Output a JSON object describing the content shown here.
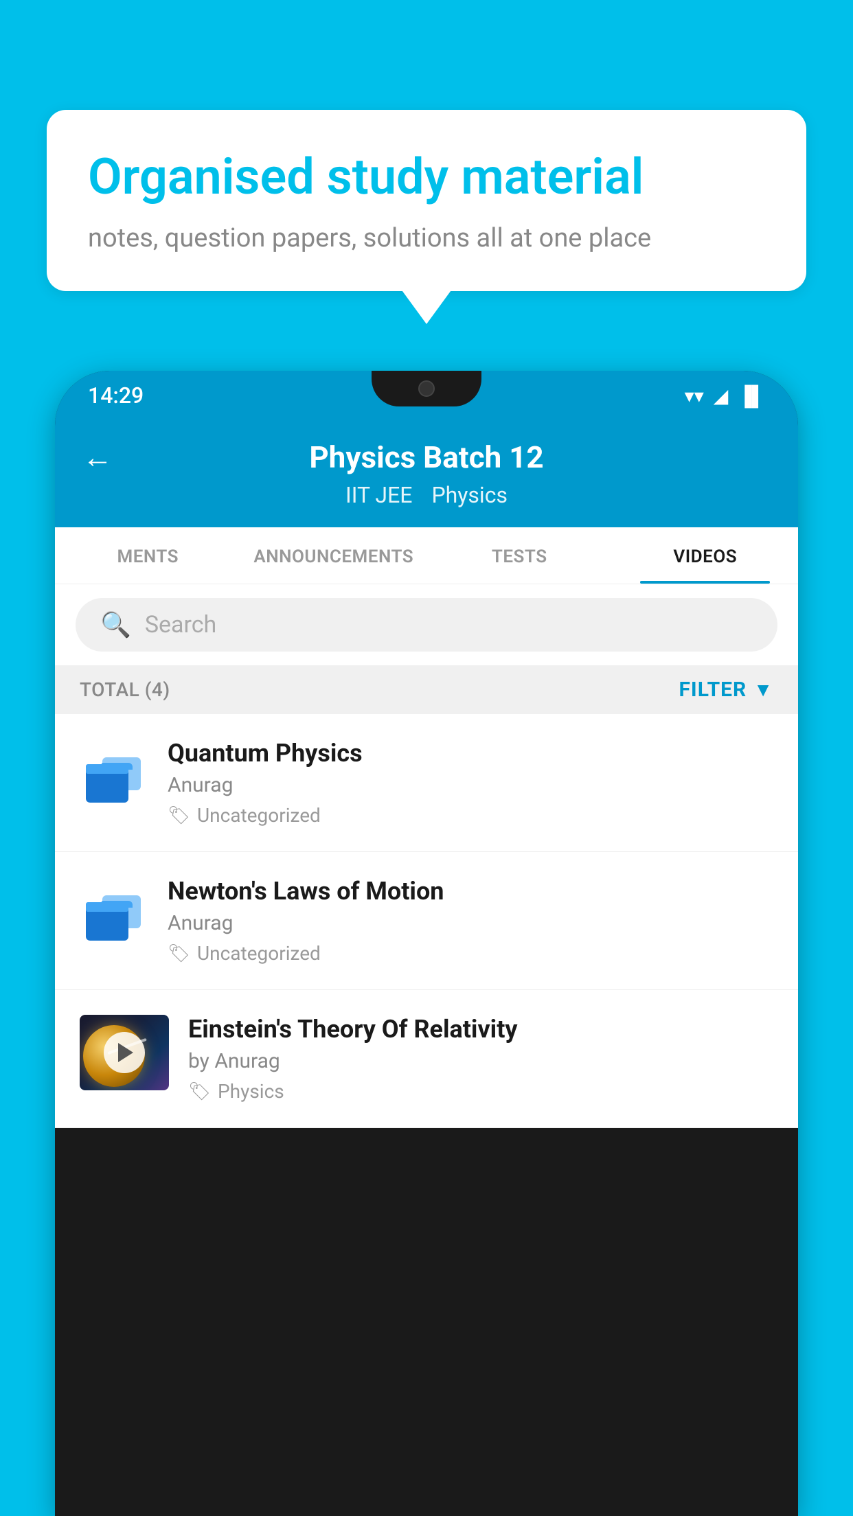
{
  "bubble": {
    "title": "Organised study material",
    "subtitle": "notes, question papers, solutions all at one place"
  },
  "statusBar": {
    "time": "14:29",
    "icons": [
      "▼",
      "◄",
      "▊"
    ]
  },
  "header": {
    "title": "Physics Batch 12",
    "subtitle1": "IIT JEE",
    "subtitle2": "Physics",
    "back_label": "←"
  },
  "tabs": [
    {
      "label": "MENTS",
      "active": false
    },
    {
      "label": "ANNOUNCEMENTS",
      "active": false
    },
    {
      "label": "TESTS",
      "active": false
    },
    {
      "label": "VIDEOS",
      "active": true
    }
  ],
  "search": {
    "placeholder": "Search"
  },
  "filterBar": {
    "total": "TOTAL (4)",
    "filter_label": "FILTER"
  },
  "videos": [
    {
      "id": 1,
      "title": "Quantum Physics",
      "author": "Anurag",
      "tag": "Uncategorized",
      "type": "folder",
      "hasThumb": false
    },
    {
      "id": 2,
      "title": "Newton's Laws of Motion",
      "author": "Anurag",
      "tag": "Uncategorized",
      "type": "folder",
      "hasThumb": false
    },
    {
      "id": 3,
      "title": "Einstein's Theory Of Relativity",
      "author": "by Anurag",
      "tag": "Physics",
      "type": "video",
      "hasThumb": true
    }
  ]
}
